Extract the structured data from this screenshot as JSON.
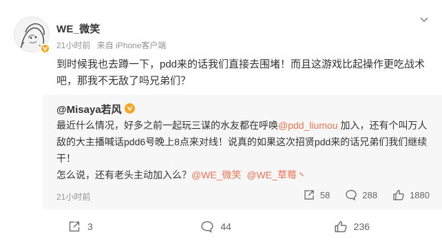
{
  "post": {
    "author": "WE_微笑",
    "time": "21小时前",
    "source": "来自 iPhone客户端",
    "content": "到时候我也去蹲一下，pdd来的话我们直接去围堵！而且这游戏比起操作更吃战术吧，那我不无敌了吗兄弟们？",
    "repost": {
      "author": "@Misaya若风",
      "body_part1": "最近什么情况，好多之前一起玩三谋的水友都在呼唤",
      "mention1": "@pdd_liumou",
      "body_part2": " 加入，还有个叫万人敌的大主播喊话pdd6号晚上8点来对线！说真的如果这次招贤pdd来的话兄弟们我们继续干！",
      "line2_text": "怎么说，还有老头主动加入么？",
      "mention2": "@WE_微笑",
      "mention3": "@WE_草莓丶",
      "time": "21小时前",
      "share_count": "58",
      "comment_count": "288",
      "like_count": "1880"
    },
    "actions": {
      "share_count": "3",
      "comment_count": "44",
      "like_count": "236"
    }
  },
  "colors": {
    "mention": "#eb7350",
    "verified_badge": "#f5a623",
    "meta_text": "#939393",
    "repost_bg": "#f7f7f7"
  },
  "icons": {
    "more": "chevron-down-icon",
    "share": "share-icon",
    "comment": "comment-icon",
    "like": "thumbs-up-icon"
  }
}
